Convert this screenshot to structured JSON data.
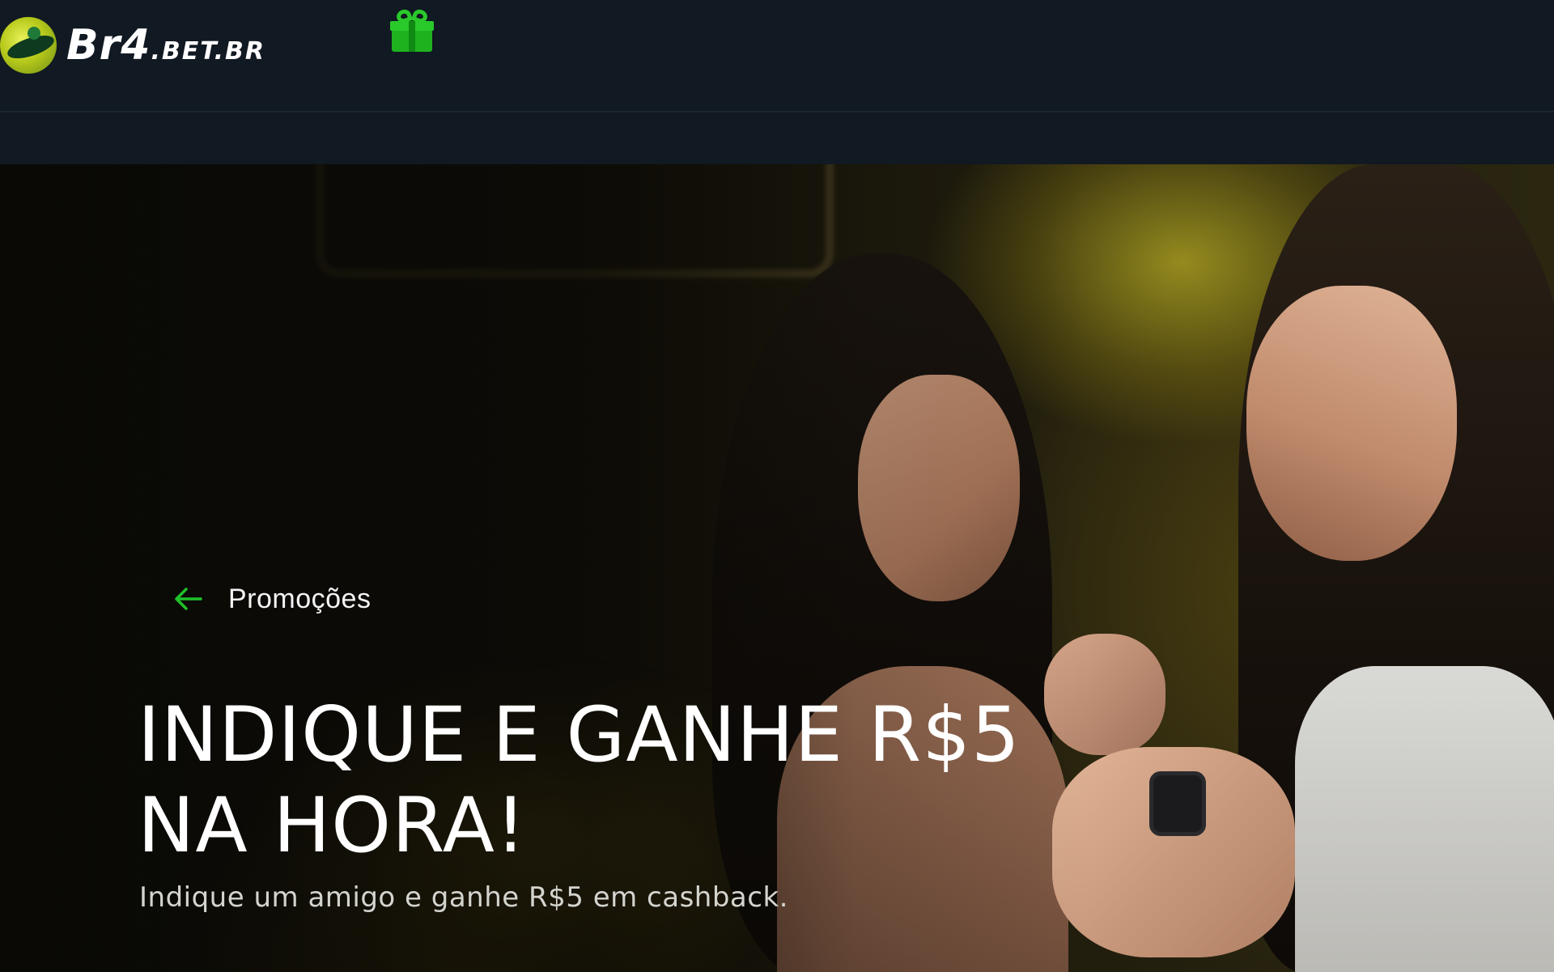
{
  "header": {
    "logo_text": "Br4",
    "logo_suffix": ".BET.BR",
    "icons": {
      "logo": "br4-logo-icon",
      "gift": "gift-icon"
    },
    "colors": {
      "background": "#111922",
      "gift": "#29c92a"
    }
  },
  "hero": {
    "back_label": "Promoções",
    "back_icon": "arrow-left-icon",
    "title_line1": "INDIQUE E GANHE R$5",
    "title_line2": "NA HORA!",
    "subtitle": "Indique um amigo e ganhe R$5 em cashback.",
    "colors": {
      "accent": "#1fc22a",
      "title": "#ffffff",
      "subtitle": "#d4d4cf"
    }
  }
}
